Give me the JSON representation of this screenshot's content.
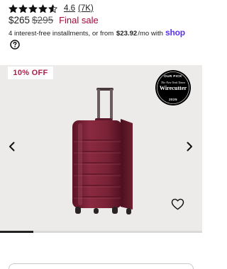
{
  "rating": {
    "stars_filled": 4.6,
    "stars_total": 5,
    "value": "4.6",
    "count": "(7K)"
  },
  "price": {
    "current": "$265",
    "original": "$295",
    "final_sale": "Final sale"
  },
  "installments": {
    "text_before": "4 interest-free installments, or from",
    "amount": "$23.92",
    "text_after": "/mo with",
    "provider": "shop"
  },
  "gallery": {
    "discount_badge": "10% OFF",
    "award_badge": {
      "top_text": "OUR PICK",
      "publisher": "The New York Times",
      "brand": "Wirecutter",
      "year": "2025"
    },
    "progress_fraction": 0.165,
    "product_color": "#7a2336"
  },
  "icons": {
    "help": "question-circle-icon",
    "prev": "chevron-left-icon",
    "next": "chevron-right-icon",
    "favorite": "heart-outline-icon"
  },
  "colors": {
    "sale": "#a10b3a",
    "shop": "#5a31f4",
    "gallery_bg": "#ecebea"
  }
}
